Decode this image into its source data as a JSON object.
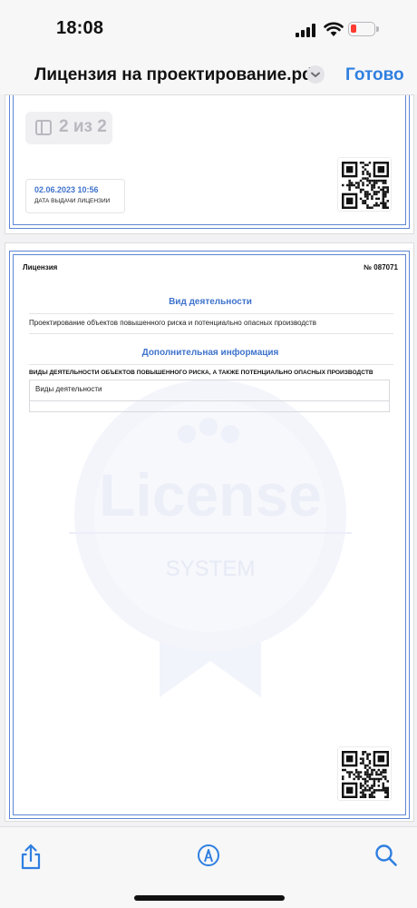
{
  "status_bar": {
    "time": "18:08",
    "battery_color": "#ff3b30"
  },
  "nav": {
    "title": "Лицензия на проектирование.pdf",
    "done_label": "Готово",
    "menu_icon": "chevron-down-icon",
    "accent": "#2f7fe0"
  },
  "page1": {
    "page_indicator": "2 из 2",
    "issue_date": "02.06.2023 10:56",
    "issue_date_caption": "ДАТА ВЫДАЧИ ЛИЦЕНЗИИ"
  },
  "page2": {
    "doc_label": "Лицензия",
    "doc_number": "№ 087071",
    "section1_title": "Вид деятельности",
    "activity_text": "Проектирование объектов повышенного риска и потенциально опасных производств",
    "section2_title": "Дополнительная информация",
    "sub_heading": "ВИДЫ ДЕЯТЕЛЬНОСТИ ОБЪЕКТОВ ПОВЫШЕННОГО РИСКА, А ТАКЖЕ ПОТЕНЦИАЛЬНО ОПАСНЫХ ПРОИЗВОДСТВ",
    "table_cell": "Виды деятельности",
    "watermark_word": "License",
    "watermark_sub": "SYSTEM",
    "heading_color": "#3f73cc"
  },
  "toolbar": {
    "share_icon": "share-icon",
    "markup_icon": "markup-pen-icon",
    "search_icon": "search-icon"
  }
}
